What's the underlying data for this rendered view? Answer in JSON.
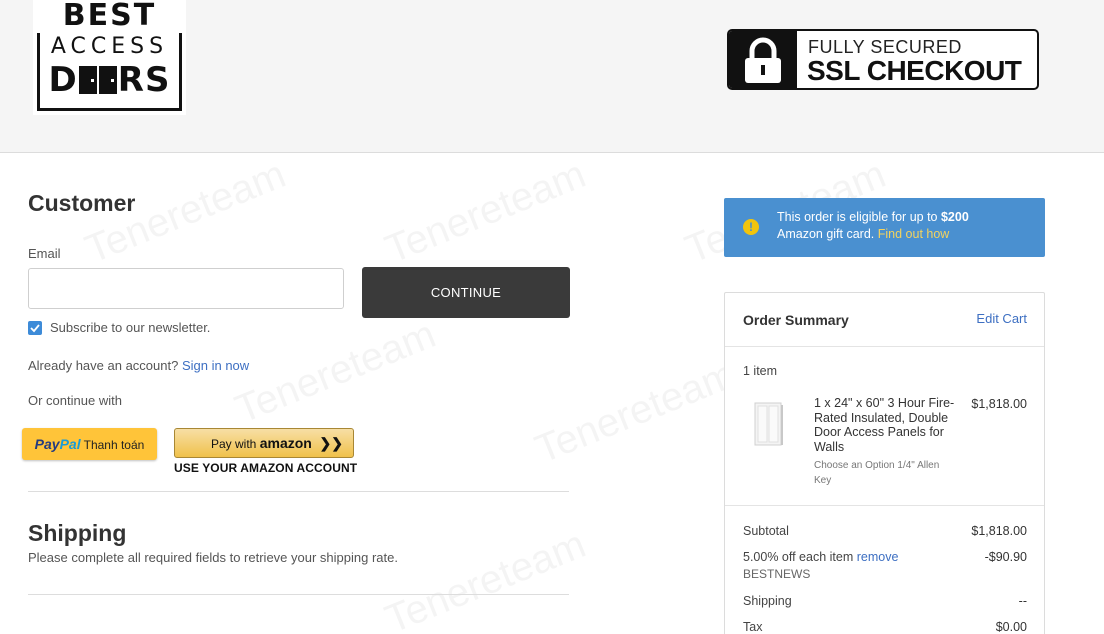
{
  "header": {
    "logo": {
      "line1": "BEST",
      "line2": "ACCESS",
      "line3_prefix": "D",
      "line3_suffix": "RS"
    },
    "ssl_badge": {
      "top": "FULLY SECURED",
      "main": "SSL CHECKOUT"
    }
  },
  "customer": {
    "heading": "Customer",
    "email_label": "Email",
    "email_value": "",
    "continue_label": "CONTINUE",
    "newsletter_label": "Subscribe to our newsletter.",
    "newsletter_checked": true,
    "account_prompt": "Already have an account?",
    "signin_label": "Sign in now",
    "or_continue": "Or continue with"
  },
  "payments": {
    "paypal": {
      "pay": "Pay",
      "pal": "Pal",
      "text": "Thanh toán"
    },
    "amazon": {
      "prefix": "Pay with",
      "brand": "amazon",
      "arrows": "❯❯",
      "caption": "USE YOUR AMAZON ACCOUNT"
    }
  },
  "shipping": {
    "heading": "Shipping",
    "note": "Please complete all required fields to retrieve your shipping rate."
  },
  "gift_card": {
    "text1": "This order is eligible for up to",
    "amount": "$200",
    "text2": "Amazon gift card.",
    "link": "Find out how"
  },
  "order_summary": {
    "title": "Order Summary",
    "edit_cart": "Edit Cart",
    "item_count": "1 item",
    "product": {
      "name": "1 x 24\" x 60\" 3 Hour Fire-Rated Insulated, Double Door Access Panels for Walls",
      "option": "Choose an Option 1/4\" Allen Key",
      "price": "$1,818.00"
    },
    "subtotal_label": "Subtotal",
    "subtotal_value": "$1,818.00",
    "discount_label": "5.00% off each item",
    "discount_remove": "remove",
    "discount_value": "-$90.90",
    "coupon_code": "BESTNEWS",
    "shipping_label": "Shipping",
    "shipping_value": "--",
    "tax_label": "Tax",
    "tax_value": "$0.00"
  },
  "colors": {
    "continue_bg": "#3a3a3a",
    "link": "#3d6fc2",
    "checkbox": "#3d8bd8",
    "gift_card_bg": "#4a90d0",
    "paypal_bg": "#ffc439",
    "amazon_bg": "#f0c14b"
  }
}
